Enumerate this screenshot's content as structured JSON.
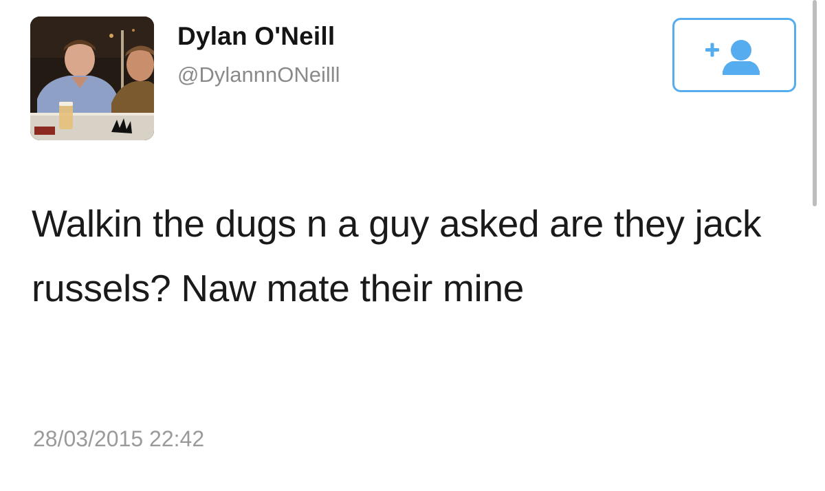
{
  "tweet": {
    "display_name": "Dylan O'Neill",
    "handle": "@DylannnONeilll",
    "text": "Walkin the dugs n a guy asked are they jack russels? Naw mate their mine",
    "timestamp": "28/03/2015 22:42"
  },
  "follow_button": {
    "icon": "follow-user-icon",
    "color": "#55acee"
  },
  "colors": {
    "accent": "#55acee",
    "handle": "#8a8a8a",
    "timestamp": "#9a9a9a",
    "text": "#1a1a1a"
  }
}
